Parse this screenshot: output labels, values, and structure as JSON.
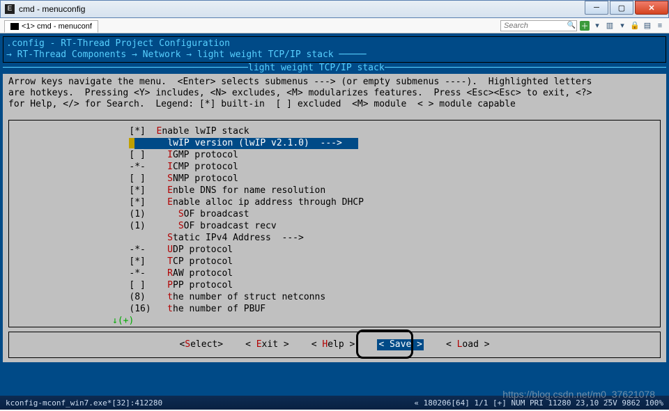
{
  "window": {
    "title": "cmd - menuconfig",
    "tab_label": "<1> cmd - menuconf",
    "search_placeholder": "Search"
  },
  "config": {
    "title": ".config - RT-Thread Project Configuration",
    "breadcrumb_prefix": "→ ",
    "breadcrumb": "RT-Thread Components → Network → light weight TCP/IP stack",
    "inner_title": " light weight TCP/IP stack "
  },
  "instructions": {
    "l1": "Arrow keys navigate the menu.  <Enter> selects submenus ---> (or empty submenus ----).  Highlighted letters",
    "l2": "are hotkeys.  Pressing <Y> includes, <N> excludes, <M> modularizes features.  Press <Esc><Esc> to exit, <?>",
    "l3": "for Help, </> for Search.  Legend: [*] built-in  [ ] excluded  <M> module  < > module capable"
  },
  "menu": [
    {
      "pre": "[*]  ",
      "hk": "E",
      "rest": "nable lwIP stack",
      "sel": false,
      "cursor": false
    },
    {
      "pre": "       ",
      "hk": "l",
      "rest": "wIP version (lwIP v2.1.0)  --->",
      "sel": true,
      "cursor": true
    },
    {
      "pre": "[ ]    ",
      "hk": "I",
      "rest": "GMP protocol",
      "sel": false,
      "cursor": false
    },
    {
      "pre": "-*-    ",
      "hk": "I",
      "rest": "CMP protocol",
      "sel": false,
      "cursor": false
    },
    {
      "pre": "[ ]    ",
      "hk": "S",
      "rest": "NMP protocol",
      "sel": false,
      "cursor": false
    },
    {
      "pre": "[*]    ",
      "hk": "E",
      "rest": "nble DNS for name resolution",
      "sel": false,
      "cursor": false
    },
    {
      "pre": "[*]    ",
      "hk": "E",
      "rest": "nable alloc ip address through DHCP",
      "sel": false,
      "cursor": false
    },
    {
      "pre": "(1)      ",
      "hk": "S",
      "rest": "OF broadcast",
      "sel": false,
      "cursor": false
    },
    {
      "pre": "(1)      ",
      "hk": "S",
      "rest": "OF broadcast recv",
      "sel": false,
      "cursor": false
    },
    {
      "pre": "       ",
      "hk": "S",
      "rest": "tatic IPv4 Address  --->",
      "sel": false,
      "cursor": false
    },
    {
      "pre": "-*-    ",
      "hk": "U",
      "rest": "DP protocol",
      "sel": false,
      "cursor": false
    },
    {
      "pre": "[*]    ",
      "hk": "T",
      "rest": "CP protocol",
      "sel": false,
      "cursor": false
    },
    {
      "pre": "-*-    ",
      "hk": "R",
      "rest": "AW protocol",
      "sel": false,
      "cursor": false
    },
    {
      "pre": "[ ]    ",
      "hk": "P",
      "rest": "PP protocol",
      "sel": false,
      "cursor": false
    },
    {
      "pre": "(8)    ",
      "hk": "t",
      "rest": "he number of struct netconns",
      "sel": false,
      "cursor": false
    },
    {
      "pre": "(16)   ",
      "hk": "t",
      "rest": "he number of PBUF",
      "sel": false,
      "cursor": false
    }
  ],
  "more_indicator": "↓(+)",
  "actions": {
    "select": {
      "hk": "S",
      "rest": "elect"
    },
    "exit": {
      "hk": "E",
      "rest": "xit"
    },
    "help": {
      "hk": "H",
      "rest": "elp"
    },
    "save": {
      "hk": "S",
      "rest": "ave"
    },
    "load": {
      "hk": "L",
      "rest": "oad"
    }
  },
  "status": {
    "left": "kconfig-mconf_win7.exe*[32]:412280",
    "right": "« 180206[64]  1/1   [+]   NUM   PRI   11280    23,10   25V   9862  100%"
  },
  "watermark": "https://blog.csdn.net/m0_37621078"
}
